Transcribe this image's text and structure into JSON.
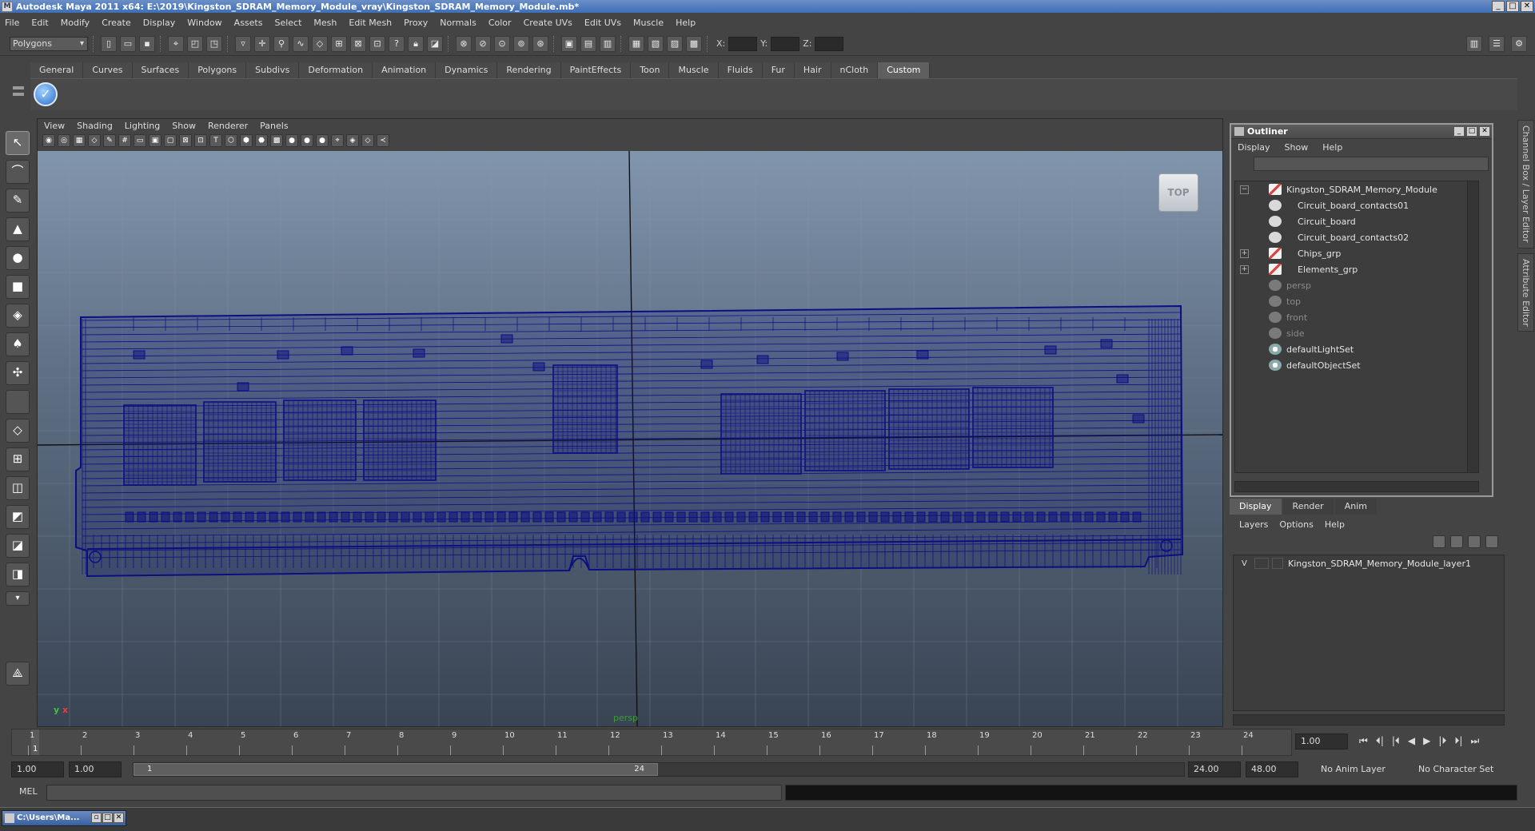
{
  "window": {
    "title": "Autodesk Maya 2011 x64: E:\\2019\\Kingston_SDRAM_Memory_Module_vray\\Kingston_SDRAM_Memory_Module.mb*",
    "min": "_",
    "max": "□",
    "close": "✕"
  },
  "menubar": [
    "File",
    "Edit",
    "Modify",
    "Create",
    "Display",
    "Window",
    "Assets",
    "Select",
    "Mesh",
    "Edit Mesh",
    "Proxy",
    "Normals",
    "Color",
    "Create UVs",
    "Edit UVs",
    "Muscle",
    "Help"
  ],
  "status_line": {
    "mode": "Polygons",
    "x_label": "X:",
    "y_label": "Y:",
    "z_label": "Z:"
  },
  "shelf": {
    "tabs": [
      "General",
      "Curves",
      "Surfaces",
      "Polygons",
      "Subdivs",
      "Deformation",
      "Animation",
      "Dynamics",
      "Rendering",
      "PaintEffects",
      "Toon",
      "Muscle",
      "Fluids",
      "Fur",
      "Hair",
      "nCloth",
      "Custom"
    ],
    "active_tab": "Custom",
    "check_icon": "✓"
  },
  "viewport": {
    "menu": [
      "View",
      "Shading",
      "Lighting",
      "Show",
      "Renderer",
      "Panels"
    ],
    "view_cube": "TOP",
    "camera": "persp",
    "wire_color": "#0c0f82",
    "axis_y": "y",
    "axis_x": "x"
  },
  "outliner": {
    "title": "Outliner",
    "menu": [
      "Display",
      "Show",
      "Help"
    ],
    "items": [
      {
        "label": "Kingston_SDRAM_Memory_Module",
        "icon": "group-icon",
        "expander": "−"
      },
      {
        "label": "Circuit_board_contacts01",
        "icon": "mesh-icon",
        "expander": ""
      },
      {
        "label": "Circuit_board",
        "icon": "mesh-icon",
        "expander": ""
      },
      {
        "label": "Circuit_board_contacts02",
        "icon": "mesh-icon",
        "expander": ""
      },
      {
        "label": "Chips_grp",
        "icon": "group-icon",
        "expander": "+"
      },
      {
        "label": "Elements_grp",
        "icon": "group-icon",
        "expander": "+"
      },
      {
        "label": "persp",
        "icon": "camera-icon",
        "expander": ""
      },
      {
        "label": "top",
        "icon": "camera-icon",
        "expander": ""
      },
      {
        "label": "front",
        "icon": "camera-icon",
        "expander": ""
      },
      {
        "label": "side",
        "icon": "camera-icon",
        "expander": ""
      },
      {
        "label": "defaultLightSet",
        "icon": "set-icon",
        "expander": ""
      },
      {
        "label": "defaultObjectSet",
        "icon": "set-icon",
        "expander": ""
      }
    ]
  },
  "layer_editor": {
    "tabs": [
      "Display",
      "Render",
      "Anim"
    ],
    "menu": [
      "Layers",
      "Options",
      "Help"
    ],
    "layer": {
      "visibility": "V",
      "name": "Kingston_SDRAM_Memory_Module_layer1"
    }
  },
  "right_strip": {
    "channel_box": "Channel Box / Layer Editor",
    "attribute_editor": "Attribute Editor"
  },
  "time_slider": {
    "ticks": [
      "1",
      "2",
      "3",
      "4",
      "5",
      "6",
      "7",
      "8",
      "9",
      "10",
      "11",
      "12",
      "13",
      "14",
      "15",
      "16",
      "17",
      "18",
      "19",
      "20",
      "21",
      "22",
      "23",
      "24"
    ],
    "current_frame_marker": "1",
    "current_time": "1.00",
    "playback": [
      "⏮",
      "⏴|",
      "|⏴",
      "◀",
      "▶",
      "|⏵",
      "⏵|",
      "⏭"
    ]
  },
  "range_slider": {
    "start_time": "1.00",
    "playback_start": "1.00",
    "range_start": "1",
    "range_end": "24",
    "playback_end": "24.00",
    "end_time": "48.00",
    "anim_layer": "No Anim Layer",
    "character_set": "No Character Set"
  },
  "command_line": {
    "label": "MEL"
  },
  "taskbar": {
    "item": "C:\\Users\\Ma..."
  }
}
